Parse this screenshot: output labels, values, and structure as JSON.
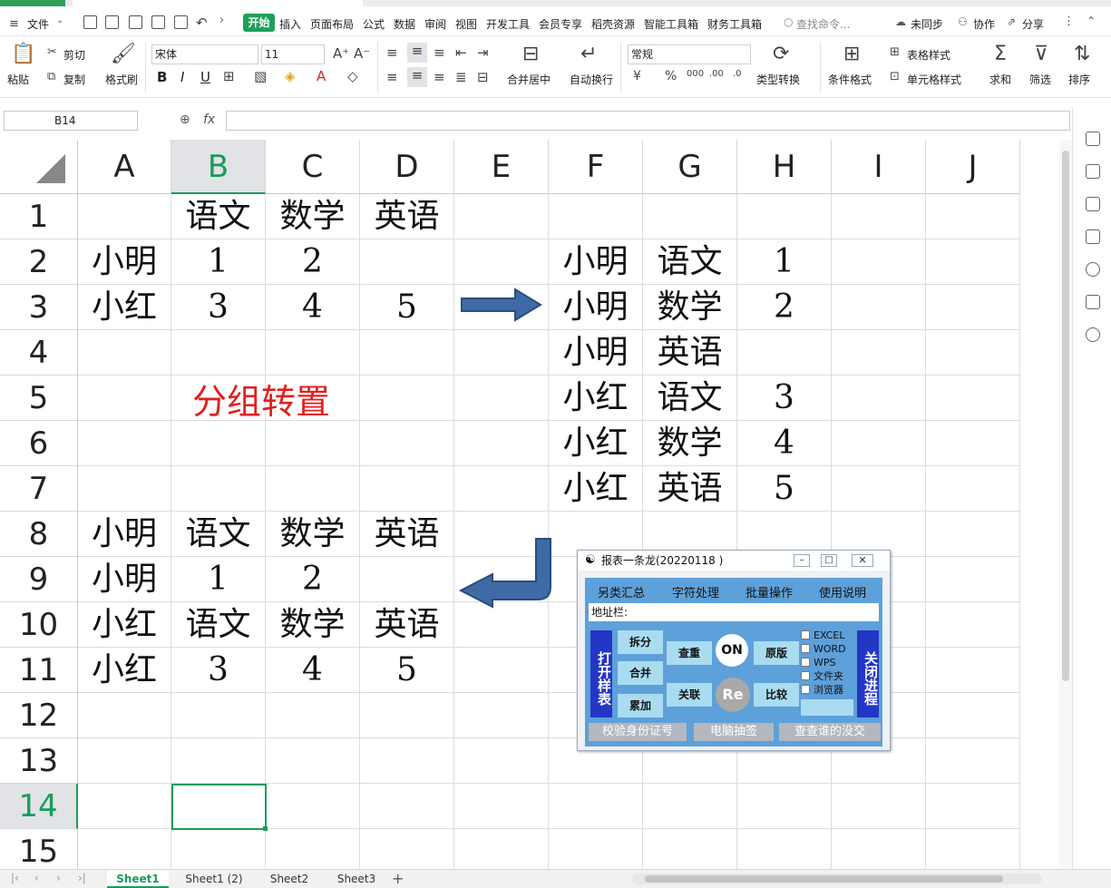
{
  "menubar": {
    "file": "文件",
    "tabs": [
      "开始",
      "插入",
      "页面布局",
      "公式",
      "数据",
      "审阅",
      "视图",
      "开发工具",
      "会员专享",
      "稻壳资源",
      "智能工具箱",
      "财务工具箱"
    ],
    "search": "查找命令...",
    "right": [
      "未同步",
      "协作",
      "分享"
    ]
  },
  "ribbon": {
    "paste": "粘贴",
    "cut": "剪切",
    "copy": "复制",
    "format_painter": "格式刷",
    "font_name": "宋体",
    "font_size": "11",
    "merge": "合并居中",
    "wrap": "自动换行",
    "number_format": "常规",
    "type_convert": "类型转换",
    "cond_format": "条件格式",
    "table_style": "表格样式",
    "cell_style": "单元格样式",
    "sum": "求和",
    "filter": "筛选",
    "sort": "排序"
  },
  "formula": {
    "name_box": "B14",
    "fx": "fx",
    "value": ""
  },
  "columns": [
    "A",
    "B",
    "C",
    "D",
    "E",
    "F",
    "G",
    "H",
    "I",
    "J"
  ],
  "rows": [
    "1",
    "2",
    "3",
    "4",
    "5",
    "6",
    "7",
    "8",
    "9",
    "10",
    "11",
    "12",
    "13",
    "14",
    "15"
  ],
  "cells": {
    "B1": "语文",
    "C1": "数学",
    "D1": "英语",
    "A2": "小明",
    "B2": "1",
    "C2": "2",
    "A3": "小红",
    "B3": "3",
    "C3": "4",
    "D3": "5",
    "F2": "小明",
    "G2": "语文",
    "H2": "1",
    "F3": "小明",
    "G3": "数学",
    "H3": "2",
    "F4": "小明",
    "G4": "英语",
    "F5": "小红",
    "G5": "语文",
    "H5": "3",
    "F6": "小红",
    "G6": "数学",
    "H6": "4",
    "F7": "小红",
    "G7": "英语",
    "H7": "5",
    "A8": "小明",
    "B8": "语文",
    "C8": "数学",
    "D8": "英语",
    "A9": "小明",
    "B9": "1",
    "C9": "2",
    "A10": "小红",
    "B10": "语文",
    "C10": "数学",
    "D10": "英语",
    "A11": "小红",
    "B11": "3",
    "C11": "4",
    "D11": "5"
  },
  "annotation": {
    "text": "分组转置",
    "color": "#e02020"
  },
  "dialog": {
    "title": "报表一条龙(20220118 )",
    "menu": [
      "另类汇总",
      "字符处理",
      "批量操作",
      "使用说明"
    ],
    "address_label": "地址栏:",
    "open_btn": "打开样表",
    "close_btn": "关闭进程",
    "buttons": [
      "拆分",
      "合并",
      "累加",
      "查重",
      "关联",
      "原版",
      "比较"
    ],
    "on": "ON",
    "re": "Re",
    "checkboxes": [
      "EXCEL",
      "WORD",
      "WPS",
      "文件夹",
      "浏览器"
    ],
    "bottom": [
      "校验身份证号",
      "电脑抽签",
      "查查谁的没交"
    ]
  },
  "sheets": [
    "Sheet1",
    "Sheet1 (2)",
    "Sheet2",
    "Sheet3"
  ],
  "colors": {
    "accent": "#1a9c5c",
    "dialog_body": "#5ea0d9",
    "arrow": "#3f6aa6"
  }
}
